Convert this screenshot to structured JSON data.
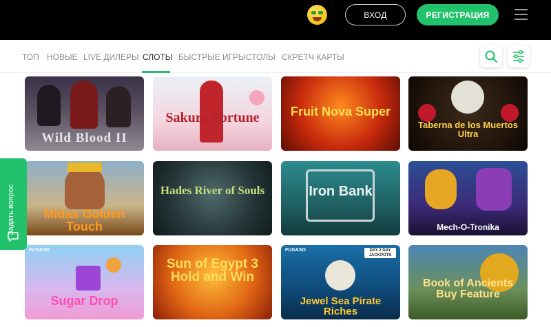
{
  "header": {
    "login_label": "ВХОД",
    "register_label": "РЕГИСТРАЦИЯ"
  },
  "nav": {
    "tabs": [
      {
        "label": "ТОП",
        "active": false
      },
      {
        "label": "НОВЫЕ",
        "active": false
      },
      {
        "label": "LIVE ДИЛЕРЫ",
        "active": false
      },
      {
        "label": "СЛОТЫ",
        "active": true
      },
      {
        "label": "БЫСТРЫЕ ИГРЫ",
        "active": false
      },
      {
        "label": "СТОЛЫ",
        "active": false
      },
      {
        "label": "СКРЕТЧ КАРТЫ",
        "active": false
      }
    ],
    "search_icon": "search-icon",
    "filter_icon": "filter-icon"
  },
  "games": [
    {
      "title": "Wild Blood II"
    },
    {
      "title": "Sakura Fortune"
    },
    {
      "title": "Fruit Nova Super"
    },
    {
      "title": "Taberna de los Muertos Ultra"
    },
    {
      "title": "Midas Golden Touch"
    },
    {
      "title": "Hades River of Souls"
    },
    {
      "title": "Iron Bank"
    },
    {
      "title": "Mech-O-Tronika"
    },
    {
      "title": "Sugar Drop"
    },
    {
      "title": "Sun of Egypt 3 Hold and Win"
    },
    {
      "title": "Jewel Sea Pirate Riches"
    },
    {
      "title": "Book of Ancients Buy Feature"
    }
  ],
  "badges": {
    "fugaso": "FUGASO",
    "jackpot": "DAY 2 DAY JACKPOTS"
  },
  "sidebar": {
    "ask_label": "Задать вопрос"
  },
  "colors": {
    "accent": "#22c16b",
    "header_bg": "#000000"
  }
}
